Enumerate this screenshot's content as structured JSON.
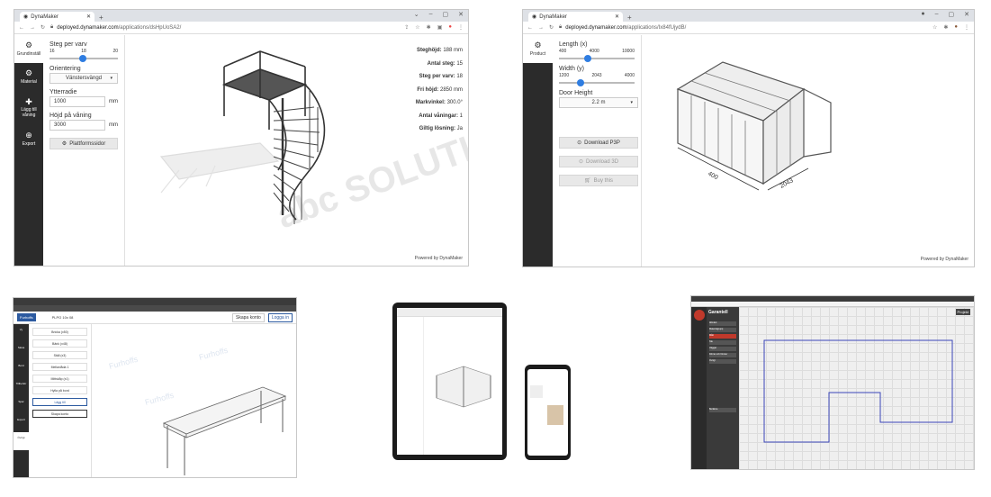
{
  "stair": {
    "tab_title": "DynaMaker",
    "url_prefix": "deployed.dynamaker.com",
    "url_path": "/applications/dsHpUoSA2/",
    "nav": [
      {
        "label": "Grundinställ",
        "icon": "gear-icon"
      },
      {
        "label": "Material",
        "icon": "gear-icon"
      },
      {
        "label": "Lägg till våning",
        "icon": "plus-icon"
      },
      {
        "label": "Export",
        "icon": "export-icon"
      }
    ],
    "slider_label": "Steg per varv",
    "slider_ticks": [
      "16",
      "18",
      "20"
    ],
    "slider_value": 18,
    "orientation_label": "Orientering",
    "orientation_value": "Vänstersvängd",
    "outer_radius_label": "Ytterradie",
    "outer_radius_value": "1000",
    "unit_mm": "mm",
    "floor_height_label": "Höjd på våning",
    "floor_height_value": "3000",
    "platform_button": "Plattformssidor",
    "stats": [
      {
        "k": "Steghöjd:",
        "v": "188 mm"
      },
      {
        "k": "Antal steg:",
        "v": "15"
      },
      {
        "k": "Steg per varv:",
        "v": "18"
      },
      {
        "k": "Fri höjd:",
        "v": "2850 mm"
      },
      {
        "k": "Markvinkel:",
        "v": "300.0°"
      },
      {
        "k": "Antal våningar:",
        "v": "1"
      },
      {
        "k": "Giltig lösning:",
        "v": "Ja"
      }
    ],
    "watermark": "abc SOLUTIONS",
    "powered": "Powered by DynaMaker"
  },
  "greenhouse": {
    "tab_title": "DynaMaker",
    "url_prefix": "deployed.dynamaker.com",
    "url_path": "/applications/Ix84fUjydB/",
    "nav": [
      {
        "label": "Product",
        "icon": "gear-icon"
      }
    ],
    "length_label": "Length (x)",
    "length_ticks": [
      "400",
      "4000",
      "10000"
    ],
    "length_value": 4000,
    "width_label": "Width (y)",
    "width_ticks": [
      "1200",
      "2043",
      "4000"
    ],
    "width_value": 2043,
    "door_label": "Door Height",
    "door_value": "2.2 m",
    "buttons": [
      "Download P3P",
      "Download 3D",
      "Buy this"
    ],
    "dim_x": "2043",
    "dim_y": "400",
    "powered": "Powered by DynaMaker"
  },
  "table": {
    "app_title": "PLPO 10x 08",
    "nav": [
      "Vy",
      "Skiva",
      "Bord",
      "Tillbehör",
      "Spar",
      "Export",
      "Övrigt"
    ],
    "options": [
      "Bricka (x50)",
      "Bänk (x48)",
      "Ställ (x3)",
      "Mellanlåda 1",
      "Mittskåp (x1)",
      "Hylla på bord",
      "Lägg till"
    ],
    "action": "Skapa konto",
    "top_buttons": [
      "Skapa konto",
      "Logga in"
    ],
    "watermark": "Furhoffs"
  },
  "garantell": {
    "brand": "Garantell",
    "top_right": "Projekt",
    "menu": [
      "Allmänt",
      "Materialgrupp",
      "Mått",
      "Tak",
      "Väggar",
      "Dörrar och fönster",
      "Övrigt"
    ],
    "footer_btn": "Beräkna"
  },
  "colors": {
    "accent": "#2f7de1",
    "nav_dark": "#2b2b2b",
    "plan_blue": "#3b46b8",
    "garantell_red": "#c0392b"
  }
}
